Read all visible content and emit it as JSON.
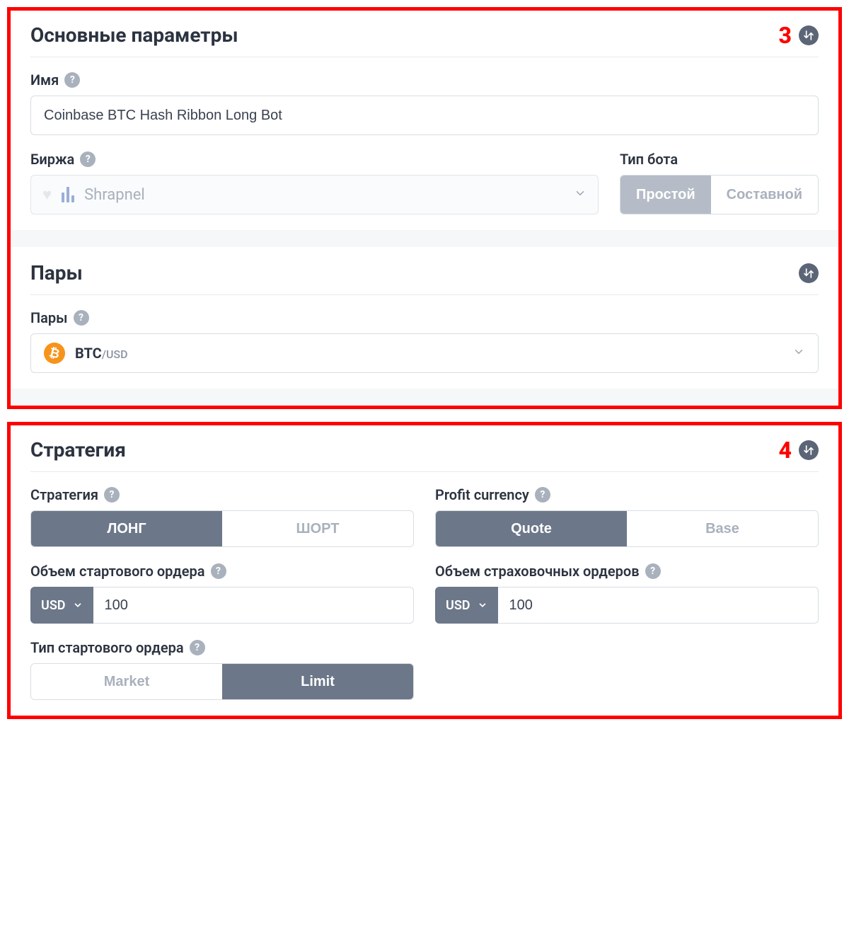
{
  "panel3": {
    "annotation": "3",
    "main_settings": {
      "title": "Основные параметры",
      "name_label": "Имя",
      "name_value": "Coinbase BTC Hash Ribbon Long Bot",
      "exchange_label": "Биржа",
      "exchange_value": "Shrapnel",
      "bot_type_label": "Тип бота",
      "bot_type_options": {
        "simple": "Простой",
        "composite": "Составной"
      }
    },
    "pairs": {
      "title": "Пары",
      "pairs_label": "Пары",
      "pair_base": "BTC",
      "pair_quote": "/USD"
    }
  },
  "panel4": {
    "annotation": "4",
    "strategy": {
      "title": "Стратегия",
      "strategy_label": "Стратегия",
      "strategy_options": {
        "long": "ЛОНГ",
        "short": "ШОРТ"
      },
      "profit_currency_label": "Profit currency",
      "profit_currency_options": {
        "quote": "Quote",
        "base": "Base"
      },
      "start_order_volume_label": "Объем стартового ордера",
      "start_order_currency": "USD",
      "start_order_value": "100",
      "safety_order_volume_label": "Объем страховочных ордеров",
      "safety_order_currency": "USD",
      "safety_order_value": "100",
      "start_order_type_label": "Тип стартового ордера",
      "start_order_type_options": {
        "market": "Market",
        "limit": "Limit"
      }
    }
  },
  "icons": {
    "help": "?"
  }
}
